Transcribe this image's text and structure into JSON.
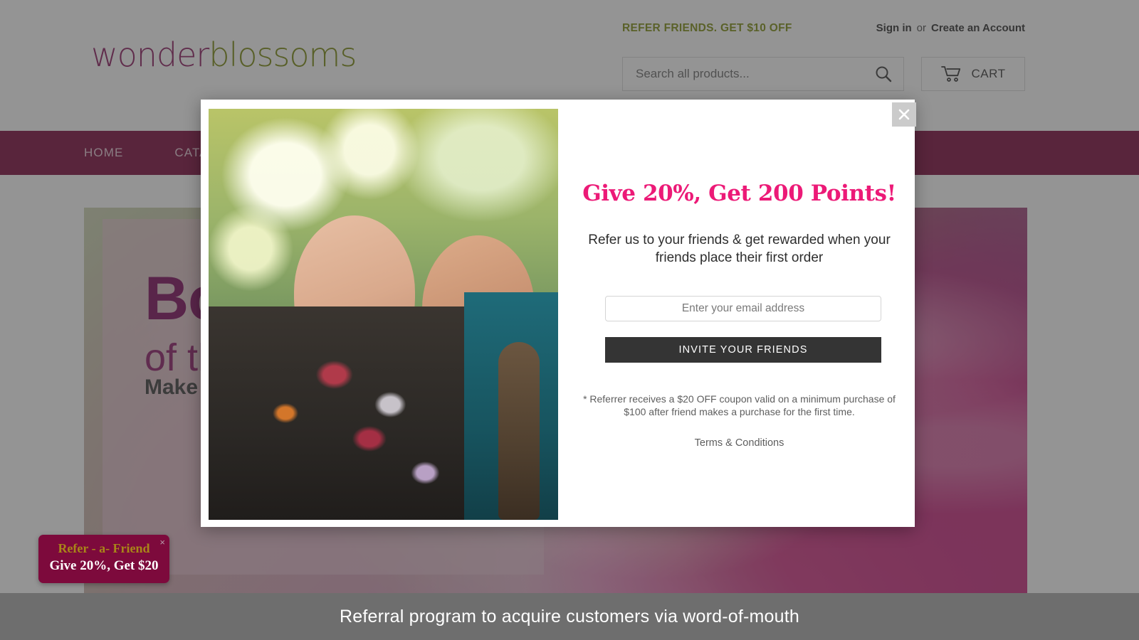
{
  "header": {
    "logo": {
      "part1": "wonder",
      "part2": "blossoms",
      "color1": "#8d1b60",
      "color2": "#7b8a10"
    },
    "promo_banner": "REFER FRIENDS. GET $10 OFF",
    "promo_color": "#7e8f12",
    "sign_in": "Sign in",
    "or": "or",
    "create_account": "Create an Account",
    "search": {
      "placeholder": "Search all products...",
      "value": "",
      "icon": "search-icon"
    },
    "cart": {
      "label": "CART",
      "icon": "shopping-cart-icon"
    }
  },
  "nav": {
    "bg_color": "#7d0a3c",
    "items": [
      {
        "label": "HOME"
      },
      {
        "label": "CATALO"
      }
    ]
  },
  "hero": {
    "title": "Bo",
    "subtitle": "of th",
    "tagline": "Make "
  },
  "widget": {
    "line1": "Refer - a- Friend",
    "line2": "Give 20%, Get $20",
    "close": "×",
    "bg_color": "#7d0a3c",
    "line1_color": "#a98618"
  },
  "modal": {
    "close_icon": "close-icon",
    "photo_alt": "two-women-outdoors-photo",
    "heading": "Give 20%, Get 200 Points!",
    "heading_color": "#ec1a77",
    "subheading": "Refer us to your friends & get rewarded when your friends place their first order",
    "email_placeholder": "Enter your email address",
    "email_value": "",
    "invite_button": "INVITE YOUR FRIENDS",
    "fine_print": "* Referrer receives a $20 OFF coupon valid on a minimum purchase of $100 after friend makes a purchase for the first time.",
    "terms_link": "Terms & Conditions"
  },
  "caption": {
    "text": "Referral program to acquire customers via word-of-mouth",
    "bg_color": "#6e6e6e"
  }
}
